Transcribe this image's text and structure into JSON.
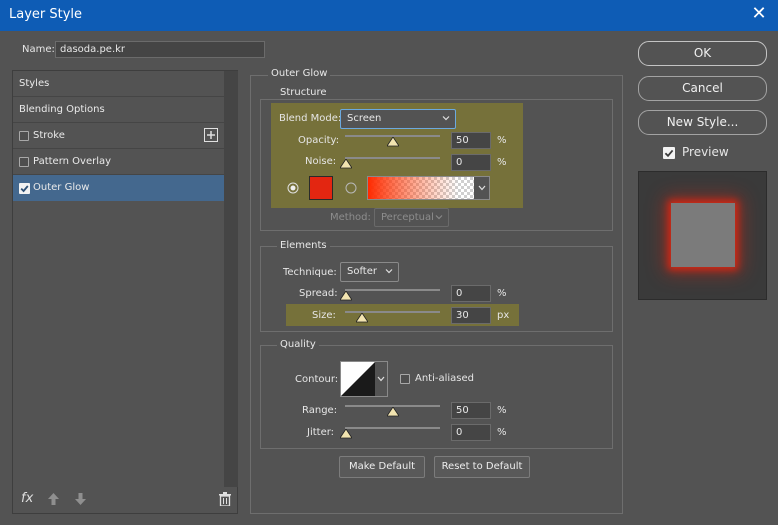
{
  "window": {
    "title": "Layer Style",
    "close_glyph": "✕"
  },
  "name_field": {
    "label": "Name:",
    "value": "dasoda.pe.kr"
  },
  "sidebar": {
    "items": [
      {
        "label": "Styles",
        "has_checkbox": false
      },
      {
        "label": "Blending Options",
        "has_checkbox": false
      },
      {
        "label": "Stroke",
        "has_checkbox": true,
        "checked": false
      },
      {
        "label": "Pattern Overlay",
        "has_checkbox": true,
        "checked": false
      },
      {
        "label": "Outer Glow",
        "has_checkbox": true,
        "checked": true,
        "selected": true
      }
    ],
    "footer_fx": "fx"
  },
  "panel": {
    "title": "Outer Glow",
    "structure": {
      "title": "Structure",
      "blend_mode": {
        "label": "Blend Mode:",
        "value": "Screen"
      },
      "opacity": {
        "label": "Opacity:",
        "value": "50",
        "unit": "%",
        "level": 0.5
      },
      "noise": {
        "label": "Noise:",
        "value": "0",
        "unit": "%",
        "level": 0
      },
      "color": "#e32611",
      "method": {
        "label": "Method:",
        "value": "Perceptual"
      }
    },
    "elements": {
      "title": "Elements",
      "technique": {
        "label": "Technique:",
        "value": "Softer"
      },
      "spread": {
        "label": "Spread:",
        "value": "0",
        "unit": "%",
        "level": 0
      },
      "size": {
        "label": "Size:",
        "value": "30",
        "unit": "px",
        "level": 0.17
      }
    },
    "quality": {
      "title": "Quality",
      "contour": {
        "label": "Contour:"
      },
      "anti_aliased": {
        "label": "Anti-aliased",
        "checked": false
      },
      "range": {
        "label": "Range:",
        "value": "50",
        "unit": "%",
        "level": 0.5
      },
      "jitter": {
        "label": "Jitter:",
        "value": "0",
        "unit": "%",
        "level": 0
      }
    },
    "make_default": "Make Default",
    "reset_default": "Reset to Default"
  },
  "buttons": {
    "ok": "OK",
    "cancel": "Cancel",
    "new_style": "New Style..."
  },
  "preview": {
    "label": "Preview",
    "checked": true
  },
  "colors": {
    "title_bar": "#0e5cb5",
    "highlight": "#76713a",
    "glow": "#e32611"
  }
}
